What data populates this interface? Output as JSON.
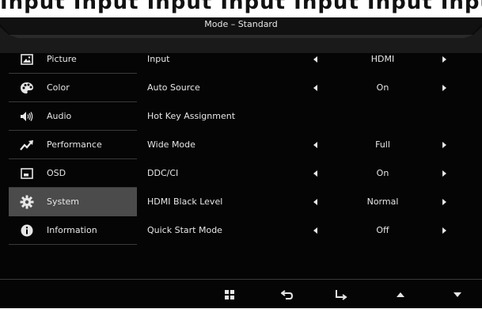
{
  "top_text": "Input Input Input Input Input Input Input",
  "header": {
    "title": "Mode – Standard"
  },
  "sidebar": {
    "items": [
      {
        "label": "Picture",
        "icon": "picture-icon"
      },
      {
        "label": "Color",
        "icon": "palette-icon"
      },
      {
        "label": "Audio",
        "icon": "speaker-icon"
      },
      {
        "label": "Performance",
        "icon": "trending-up-icon"
      },
      {
        "label": "OSD",
        "icon": "osd-window-icon"
      },
      {
        "label": "System",
        "icon": "gear-icon",
        "active": true
      },
      {
        "label": "Information",
        "icon": "info-icon"
      }
    ]
  },
  "settings": {
    "rows": [
      {
        "label": "Input",
        "value": "HDMI"
      },
      {
        "label": "Auto Source",
        "value": "On"
      },
      {
        "label": "Hot Key Assignment",
        "value": ""
      },
      {
        "label": "Wide Mode",
        "value": "Full"
      },
      {
        "label": "DDC/CI",
        "value": "On"
      },
      {
        "label": "HDMI Black Level",
        "value": "Normal"
      },
      {
        "label": "Quick Start Mode",
        "value": "Off"
      }
    ]
  },
  "footer": {
    "buttons": [
      "menu-grid-icon",
      "back-icon",
      "enter-icon",
      "up-icon",
      "down-icon"
    ]
  },
  "colors": {
    "background": "#050505",
    "active": "#4b4b4b",
    "text": "#e6e6e6"
  }
}
